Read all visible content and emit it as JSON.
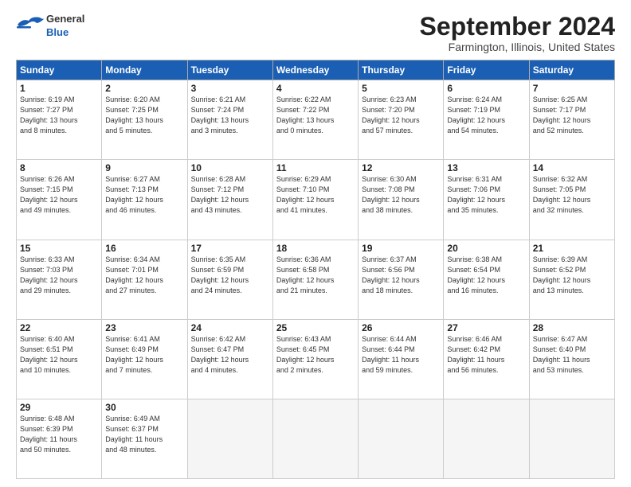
{
  "header": {
    "logo_general": "General",
    "logo_blue": "Blue",
    "month_title": "September 2024",
    "location": "Farmington, Illinois, United States"
  },
  "days_of_week": [
    "Sunday",
    "Monday",
    "Tuesday",
    "Wednesday",
    "Thursday",
    "Friday",
    "Saturday"
  ],
  "weeks": [
    [
      {
        "num": "1",
        "info": "Sunrise: 6:19 AM\nSunset: 7:27 PM\nDaylight: 13 hours\nand 8 minutes."
      },
      {
        "num": "2",
        "info": "Sunrise: 6:20 AM\nSunset: 7:25 PM\nDaylight: 13 hours\nand 5 minutes."
      },
      {
        "num": "3",
        "info": "Sunrise: 6:21 AM\nSunset: 7:24 PM\nDaylight: 13 hours\nand 3 minutes."
      },
      {
        "num": "4",
        "info": "Sunrise: 6:22 AM\nSunset: 7:22 PM\nDaylight: 13 hours\nand 0 minutes."
      },
      {
        "num": "5",
        "info": "Sunrise: 6:23 AM\nSunset: 7:20 PM\nDaylight: 12 hours\nand 57 minutes."
      },
      {
        "num": "6",
        "info": "Sunrise: 6:24 AM\nSunset: 7:19 PM\nDaylight: 12 hours\nand 54 minutes."
      },
      {
        "num": "7",
        "info": "Sunrise: 6:25 AM\nSunset: 7:17 PM\nDaylight: 12 hours\nand 52 minutes."
      }
    ],
    [
      {
        "num": "8",
        "info": "Sunrise: 6:26 AM\nSunset: 7:15 PM\nDaylight: 12 hours\nand 49 minutes."
      },
      {
        "num": "9",
        "info": "Sunrise: 6:27 AM\nSunset: 7:13 PM\nDaylight: 12 hours\nand 46 minutes."
      },
      {
        "num": "10",
        "info": "Sunrise: 6:28 AM\nSunset: 7:12 PM\nDaylight: 12 hours\nand 43 minutes."
      },
      {
        "num": "11",
        "info": "Sunrise: 6:29 AM\nSunset: 7:10 PM\nDaylight: 12 hours\nand 41 minutes."
      },
      {
        "num": "12",
        "info": "Sunrise: 6:30 AM\nSunset: 7:08 PM\nDaylight: 12 hours\nand 38 minutes."
      },
      {
        "num": "13",
        "info": "Sunrise: 6:31 AM\nSunset: 7:06 PM\nDaylight: 12 hours\nand 35 minutes."
      },
      {
        "num": "14",
        "info": "Sunrise: 6:32 AM\nSunset: 7:05 PM\nDaylight: 12 hours\nand 32 minutes."
      }
    ],
    [
      {
        "num": "15",
        "info": "Sunrise: 6:33 AM\nSunset: 7:03 PM\nDaylight: 12 hours\nand 29 minutes."
      },
      {
        "num": "16",
        "info": "Sunrise: 6:34 AM\nSunset: 7:01 PM\nDaylight: 12 hours\nand 27 minutes."
      },
      {
        "num": "17",
        "info": "Sunrise: 6:35 AM\nSunset: 6:59 PM\nDaylight: 12 hours\nand 24 minutes."
      },
      {
        "num": "18",
        "info": "Sunrise: 6:36 AM\nSunset: 6:58 PM\nDaylight: 12 hours\nand 21 minutes."
      },
      {
        "num": "19",
        "info": "Sunrise: 6:37 AM\nSunset: 6:56 PM\nDaylight: 12 hours\nand 18 minutes."
      },
      {
        "num": "20",
        "info": "Sunrise: 6:38 AM\nSunset: 6:54 PM\nDaylight: 12 hours\nand 16 minutes."
      },
      {
        "num": "21",
        "info": "Sunrise: 6:39 AM\nSunset: 6:52 PM\nDaylight: 12 hours\nand 13 minutes."
      }
    ],
    [
      {
        "num": "22",
        "info": "Sunrise: 6:40 AM\nSunset: 6:51 PM\nDaylight: 12 hours\nand 10 minutes."
      },
      {
        "num": "23",
        "info": "Sunrise: 6:41 AM\nSunset: 6:49 PM\nDaylight: 12 hours\nand 7 minutes."
      },
      {
        "num": "24",
        "info": "Sunrise: 6:42 AM\nSunset: 6:47 PM\nDaylight: 12 hours\nand 4 minutes."
      },
      {
        "num": "25",
        "info": "Sunrise: 6:43 AM\nSunset: 6:45 PM\nDaylight: 12 hours\nand 2 minutes."
      },
      {
        "num": "26",
        "info": "Sunrise: 6:44 AM\nSunset: 6:44 PM\nDaylight: 11 hours\nand 59 minutes."
      },
      {
        "num": "27",
        "info": "Sunrise: 6:46 AM\nSunset: 6:42 PM\nDaylight: 11 hours\nand 56 minutes."
      },
      {
        "num": "28",
        "info": "Sunrise: 6:47 AM\nSunset: 6:40 PM\nDaylight: 11 hours\nand 53 minutes."
      }
    ],
    [
      {
        "num": "29",
        "info": "Sunrise: 6:48 AM\nSunset: 6:39 PM\nDaylight: 11 hours\nand 50 minutes."
      },
      {
        "num": "30",
        "info": "Sunrise: 6:49 AM\nSunset: 6:37 PM\nDaylight: 11 hours\nand 48 minutes."
      },
      {
        "num": "",
        "info": ""
      },
      {
        "num": "",
        "info": ""
      },
      {
        "num": "",
        "info": ""
      },
      {
        "num": "",
        "info": ""
      },
      {
        "num": "",
        "info": ""
      }
    ]
  ]
}
